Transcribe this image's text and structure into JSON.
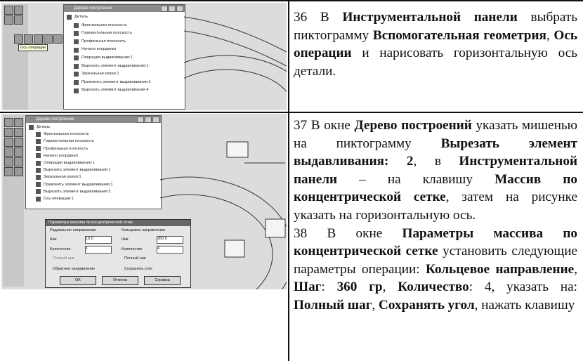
{
  "row1": {
    "screenshot": {
      "window_title": "Дерево построения",
      "tooltip": "Ось операции",
      "tree_items": [
        "Деталь",
        "Фронтальная плоскость",
        "Горизонтальная плоскость",
        "Профильная плоскость",
        "Начало координат",
        "Операция выдавливания:1",
        "Вырезать элемент выдавливания:1",
        "Зеркальная копия:1",
        "Приклеить элемент выдавливания:1",
        "Вырезать элемент выдавливания:4"
      ]
    }
  },
  "row2": {
    "screenshot": {
      "window_title": "Дерево построения",
      "tree_items": [
        "Деталь",
        "Фронтальная плоскость",
        "Горизонтальная плоскость",
        "Профильная плоскость",
        "Начало координат",
        "Операция выдавливания:1",
        "Вырезать элемент выдавливания:1",
        "Зеркальная копия:1",
        "Приклеить элемент выдавливания:1",
        "Вырезать элемент выдавливания:2",
        "Ось операции:1"
      ],
      "dialog": {
        "title": "Параметры массива по концентрической сетке",
        "radial_group": "Радиальное направление",
        "circular_group": "Кольцевое направление",
        "step_label": "Шаг",
        "step_radial_value": "10.0",
        "step_circular_value": "360.0",
        "count_label": "Количество",
        "count_radial_value": "1",
        "count_circular_value": "4",
        "full_step": "Полный шаг",
        "full_step_left": "Полный шаг",
        "reverse_direction": "Обратное направление",
        "keep_angle": "Сохранять угол",
        "ok": "OK",
        "cancel": "Отмена",
        "help": "Справка"
      }
    }
  }
}
